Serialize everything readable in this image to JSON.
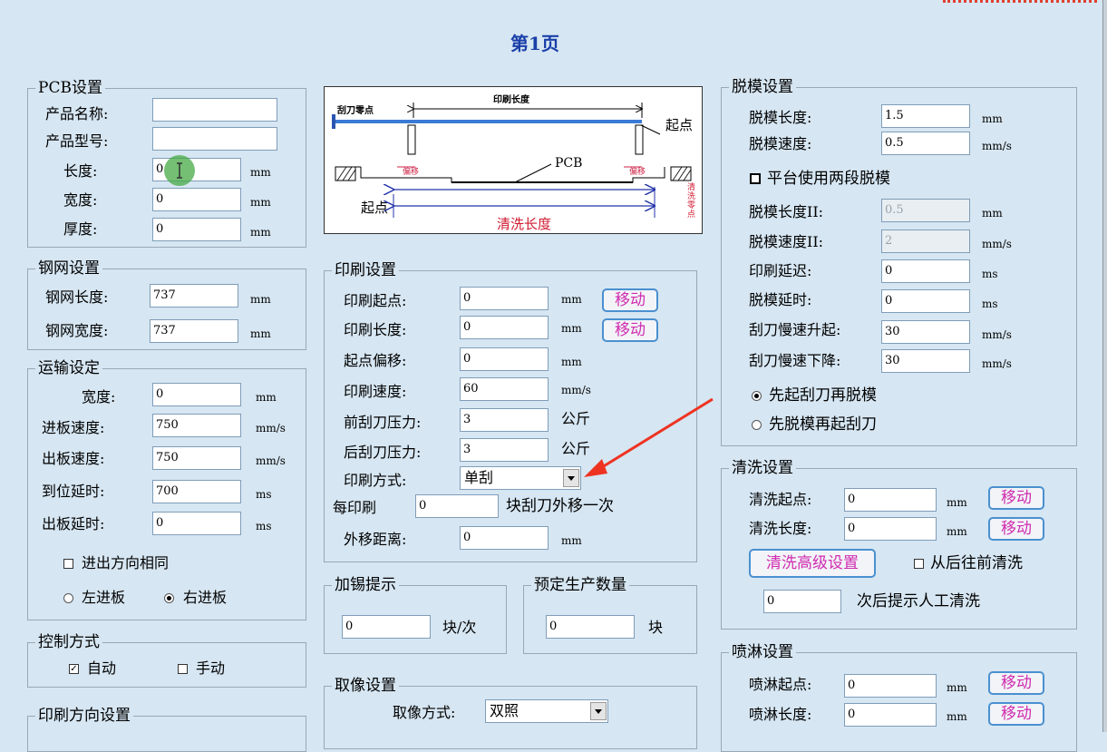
{
  "page_title": "第1页",
  "pcb": {
    "title": "PCB设置",
    "name_label": "产品名称:",
    "name_value": "",
    "model_label": "产品型号:",
    "model_value": "",
    "length_label": "长度:",
    "length_value": "0",
    "length_unit": "mm",
    "width_label": "宽度:",
    "width_value": "0",
    "width_unit": "mm",
    "thickness_label": "厚度:",
    "thickness_value": "0",
    "thickness_unit": "mm"
  },
  "stencil": {
    "title": "钢网设置",
    "length_label": "钢网长度:",
    "length_value": "737",
    "length_unit": "mm",
    "width_label": "钢网宽度:",
    "width_value": "737",
    "width_unit": "mm"
  },
  "transport": {
    "title": "运输设定",
    "width_label": "宽度:",
    "width_value": "0",
    "width_unit": "mm",
    "in_speed_label": "进板速度:",
    "in_speed_value": "750",
    "in_speed_unit": "mm/s",
    "out_speed_label": "出板速度:",
    "out_speed_value": "750",
    "out_speed_unit": "mm/s",
    "arrive_delay_label": "到位延时:",
    "arrive_delay_value": "700",
    "arrive_delay_unit": "ms",
    "out_delay_label": "出板延时:",
    "out_delay_value": "0",
    "out_delay_unit": "ms",
    "same_direction_label": "进出方向相同",
    "left_in_label": "左进板",
    "right_in_label": "右进板"
  },
  "control": {
    "title": "控制方式",
    "auto_label": "自动",
    "manual_label": "手动"
  },
  "print_direction": {
    "title": "印刷方向设置"
  },
  "diagram": {
    "print_length": "印刷长度",
    "squeegee_zero": "刮刀零点",
    "start_point_top": "起点",
    "offset_left": "偏移",
    "offset_right": "偏移",
    "pcb": "PCB",
    "start_point_bottom": "起点",
    "clean_length": "清洗长度",
    "clean_zero": "清洗零点"
  },
  "print": {
    "title": "印刷设置",
    "start_label": "印刷起点:",
    "start_value": "0",
    "start_unit": "mm",
    "start_move": "移动",
    "length_label": "印刷长度:",
    "length_value": "0",
    "length_unit": "mm",
    "length_move": "移动",
    "offset_label": "起点偏移:",
    "offset_value": "0",
    "offset_unit": "mm",
    "speed_label": "印刷速度:",
    "speed_value": "60",
    "speed_unit": "mm/s",
    "front_pressure_label": "前刮刀压力:",
    "front_pressure_value": "3",
    "front_pressure_unit": "公斤",
    "rear_pressure_label": "后刮刀压力:",
    "rear_pressure_value": "3",
    "rear_pressure_unit": "公斤",
    "mode_label": "印刷方式:",
    "mode_value": "单刮",
    "every_label": "每印刷",
    "every_value": "0",
    "every_suffix": "块刮刀外移一次",
    "shift_label": "外移距离:",
    "shift_value": "0",
    "shift_unit": "mm"
  },
  "solder": {
    "title": "加锡提示",
    "value": "0",
    "unit": "块/次"
  },
  "production": {
    "title": "预定生产数量",
    "value": "0",
    "unit": "块"
  },
  "camera": {
    "title": "取像设置",
    "mode_label": "取像方式:",
    "mode_value": "双照"
  },
  "demold": {
    "title": "脱模设置",
    "length_label": "脱模长度:",
    "length_value": "1.5",
    "length_unit": "mm",
    "speed_label": "脱模速度:",
    "speed_value": "0.5",
    "speed_unit": "mm/s",
    "two_stage_label": "平台使用两段脱模",
    "length2_label": "脱模长度II:",
    "length2_value": "0.5",
    "length2_unit": "mm",
    "speed2_label": "脱模速度II:",
    "speed2_value": "2",
    "speed2_unit": "mm/s",
    "print_delay_label": "印刷延迟:",
    "print_delay_value": "0",
    "print_delay_unit": "ms",
    "demold_delay_label": "脱模延时:",
    "demold_delay_value": "0",
    "demold_delay_unit": "ms",
    "slow_up_label": "刮刀慢速升起:",
    "slow_up_value": "30",
    "slow_up_unit": "mm/s",
    "slow_down_label": "刮刀慢速下降:",
    "slow_down_value": "30",
    "slow_down_unit": "mm/s",
    "option_first_label": "先起刮刀再脱模",
    "option_second_label": "先脱模再起刮刀"
  },
  "clean": {
    "title": "清洗设置",
    "start_label": "清洗起点:",
    "start_value": "0",
    "start_unit": "mm",
    "start_move": "移动",
    "length_label": "清洗长度:",
    "length_value": "0",
    "length_unit": "mm",
    "length_move": "移动",
    "advanced_label": "清洗高级设置",
    "back_to_front_label": "从后往前清洗",
    "prompt_value": "0",
    "prompt_suffix": "次后提示人工清洗"
  },
  "spray": {
    "title": "喷淋设置",
    "start_label": "喷淋起点:",
    "start_value": "0",
    "start_unit": "mm",
    "start_move": "移动",
    "length_label": "喷淋长度:",
    "length_value": "0",
    "length_unit": "mm",
    "length_move": "移动"
  },
  "colors": {
    "background": "#d6e6f2",
    "title": "#1a3fa8",
    "move_text": "#d02cb0",
    "arrow": "#ee3322"
  }
}
